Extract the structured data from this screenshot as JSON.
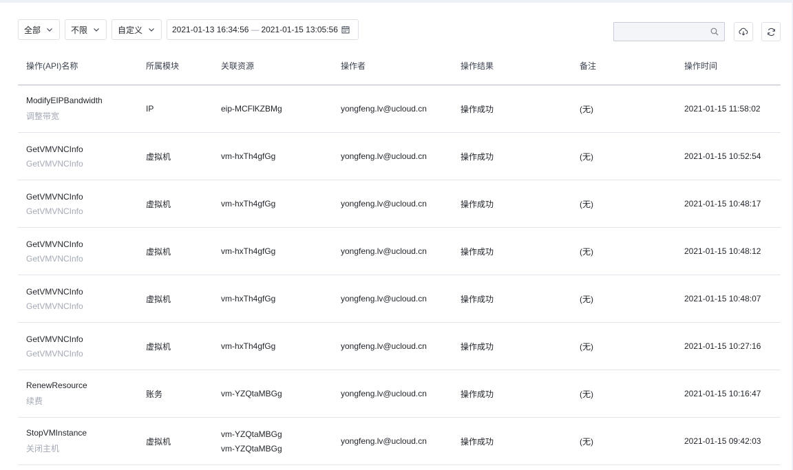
{
  "filters": {
    "scope": "全部",
    "limit": "不限",
    "range_type": "自定义",
    "date_start": "2021-01-13 16:34:56",
    "date_sep": "—",
    "date_end": "2021-01-15 13:05:56"
  },
  "search": {
    "value": "",
    "placeholder": ""
  },
  "icons": {
    "chevron": "chevron-down-icon",
    "calendar": "calendar-icon",
    "search": "search-icon",
    "download": "cloud-download-icon",
    "refresh": "refresh-icon"
  },
  "table": {
    "headers": [
      "操作(API)名称",
      "所属模块",
      "关联资源",
      "操作者",
      "操作结果",
      "备注",
      "操作时间"
    ],
    "rows": [
      {
        "api": "ModifyEIPBandwidth",
        "api_desc": "调整带宽",
        "module": "IP",
        "resources": [
          "eip-MCFlKZBMg"
        ],
        "operator": "yongfeng.lv@ucloud.cn",
        "result": "操作成功",
        "remark": "(无)",
        "time": "2021-01-15 11:58:02"
      },
      {
        "api": "GetVMVNCInfo",
        "api_desc": "GetVMVNCInfo",
        "module": "虚拟机",
        "resources": [
          "vm-hxTh4gfGg"
        ],
        "operator": "yongfeng.lv@ucloud.cn",
        "result": "操作成功",
        "remark": "(无)",
        "time": "2021-01-15 10:52:54"
      },
      {
        "api": "GetVMVNCInfo",
        "api_desc": "GetVMVNCInfo",
        "module": "虚拟机",
        "resources": [
          "vm-hxTh4gfGg"
        ],
        "operator": "yongfeng.lv@ucloud.cn",
        "result": "操作成功",
        "remark": "(无)",
        "time": "2021-01-15 10:48:17"
      },
      {
        "api": "GetVMVNCInfo",
        "api_desc": "GetVMVNCInfo",
        "module": "虚拟机",
        "resources": [
          "vm-hxTh4gfGg"
        ],
        "operator": "yongfeng.lv@ucloud.cn",
        "result": "操作成功",
        "remark": "(无)",
        "time": "2021-01-15 10:48:12"
      },
      {
        "api": "GetVMVNCInfo",
        "api_desc": "GetVMVNCInfo",
        "module": "虚拟机",
        "resources": [
          "vm-hxTh4gfGg"
        ],
        "operator": "yongfeng.lv@ucloud.cn",
        "result": "操作成功",
        "remark": "(无)",
        "time": "2021-01-15 10:48:07"
      },
      {
        "api": "GetVMVNCInfo",
        "api_desc": "GetVMVNCInfo",
        "module": "虚拟机",
        "resources": [
          "vm-hxTh4gfGg"
        ],
        "operator": "yongfeng.lv@ucloud.cn",
        "result": "操作成功",
        "remark": "(无)",
        "time": "2021-01-15 10:27:16"
      },
      {
        "api": "RenewResource",
        "api_desc": "续费",
        "module": "账务",
        "resources": [
          "vm-YZQtaMBGg"
        ],
        "operator": "yongfeng.lv@ucloud.cn",
        "result": "操作成功",
        "remark": "(无)",
        "time": "2021-01-15 10:16:47"
      },
      {
        "api": "StopVMInstance",
        "api_desc": "关闭主机",
        "module": "虚拟机",
        "resources": [
          "vm-YZQtaMBGg",
          "vm-YZQtaMBGg"
        ],
        "operator": "yongfeng.lv@ucloud.cn",
        "result": "操作成功",
        "remark": "(无)",
        "time": "2021-01-15 09:42:03"
      }
    ]
  }
}
